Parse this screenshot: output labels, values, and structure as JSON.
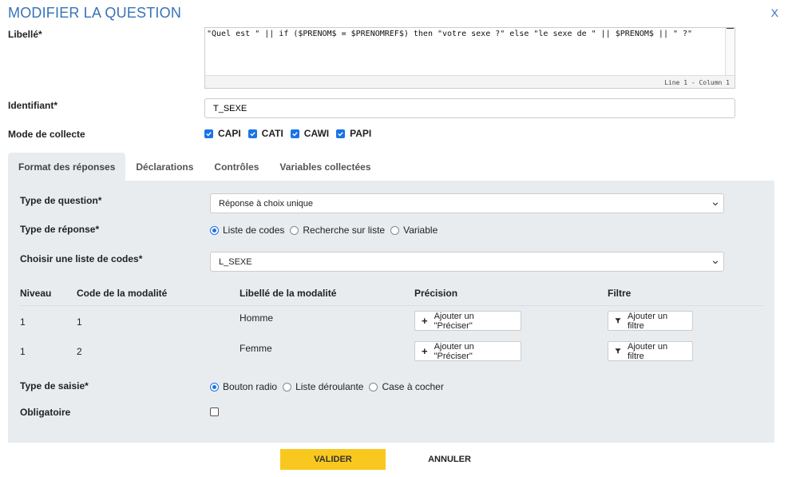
{
  "dialog": {
    "title": "MODIFIER LA QUESTION",
    "close_label": "X"
  },
  "form": {
    "libelle_label": "Libellé*",
    "libelle_code": "\"Quel est \" || if ($PRENOM$ = $PRENOMREF$) then \"votre sexe ?\" else \"le sexe de \" || $PRENOM$ || \" ?\"",
    "editor_status": "Line 1 - Column 1",
    "identifiant_label": "Identifiant*",
    "identifiant_value": "T_SEXE",
    "mode_label": "Mode de collecte",
    "modes": [
      {
        "label": "CAPI",
        "checked": true
      },
      {
        "label": "CATI",
        "checked": true
      },
      {
        "label": "CAWI",
        "checked": true
      },
      {
        "label": "PAPI",
        "checked": true
      }
    ]
  },
  "tabs": [
    {
      "label": "Format des réponses",
      "active": true
    },
    {
      "label": "Déclarations",
      "active": false
    },
    {
      "label": "Contrôles",
      "active": false
    },
    {
      "label": "Variables collectées",
      "active": false
    }
  ],
  "panel": {
    "type_question_label": "Type de question*",
    "type_question_value": "Réponse à choix unique",
    "type_reponse_label": "Type de réponse*",
    "type_reponse_options": [
      {
        "label": "Liste de codes",
        "selected": true
      },
      {
        "label": "Recherche sur liste",
        "selected": false
      },
      {
        "label": "Variable",
        "selected": false
      }
    ],
    "liste_codes_label": "Choisir une liste de codes*",
    "liste_codes_value": "L_SEXE",
    "table": {
      "headers": [
        "Niveau",
        "Code de la modalité",
        "Libellé de la modalité",
        "Précision",
        "Filtre"
      ],
      "rows": [
        {
          "niveau": "1",
          "code": "1",
          "libelle": "Homme",
          "precision_btn": "Ajouter un \"Préciser\"",
          "filtre_btn": "Ajouter un filtre"
        },
        {
          "niveau": "1",
          "code": "2",
          "libelle": "Femme",
          "precision_btn": "Ajouter un \"Préciser\"",
          "filtre_btn": "Ajouter un filtre"
        }
      ]
    },
    "type_saisie_label": "Type de saisie*",
    "type_saisie_options": [
      {
        "label": "Bouton radio",
        "selected": true
      },
      {
        "label": "Liste déroulante",
        "selected": false
      },
      {
        "label": "Case à cocher",
        "selected": false
      }
    ],
    "obligatoire_label": "Obligatoire",
    "obligatoire_checked": false
  },
  "actions": {
    "valider": "VALIDER",
    "annuler": "ANNULER"
  },
  "colors": {
    "accent": "#3873b6",
    "checkbox": "#1a73e8",
    "primary_button": "#f8c81e",
    "panel_bg": "#e9ecef"
  }
}
